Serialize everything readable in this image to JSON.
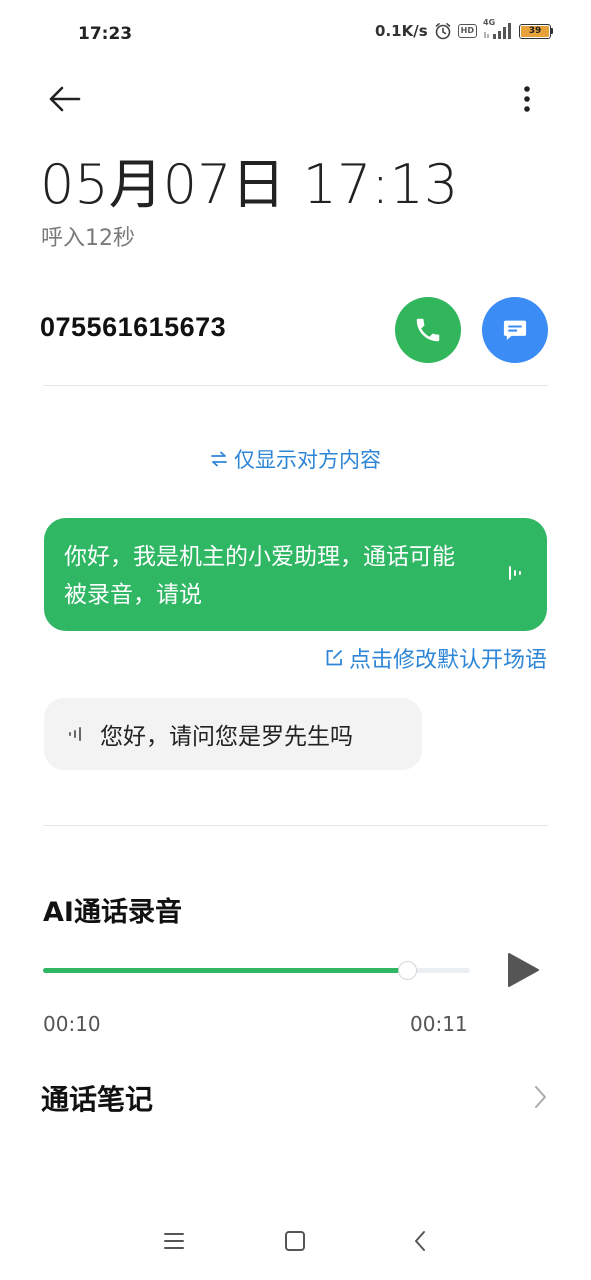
{
  "status_bar": {
    "time": "17:23",
    "network_speed": "0.1K/s",
    "hd_label": "HD",
    "network_type": "4G",
    "battery": "39",
    "battery_level_percent": 39,
    "battery_color": "#e8a23a"
  },
  "header": {
    "back_icon": "arrow-left-icon",
    "more_icon": "more-vertical-icon"
  },
  "call": {
    "datetime": "05月07日 17:13",
    "subtitle": "呼入12秒",
    "phone_number": "075561615673",
    "call_button_color": "#32b65c",
    "message_button_color": "#3b8df5"
  },
  "transcript": {
    "toggle_label": "仅显示对方内容",
    "outgoing_text": "你好，我是机主的小爱助理，通话可能被录音，请说",
    "edit_label": "点击修改默认开场语",
    "incoming_text": "您好，请问您是罗先生吗"
  },
  "recording": {
    "title": "AI通话录音",
    "current_time": "00:10",
    "total_time": "00:11",
    "progress_percent": 86,
    "accent_color": "#2fb764"
  },
  "notes": {
    "label": "通话笔记"
  }
}
